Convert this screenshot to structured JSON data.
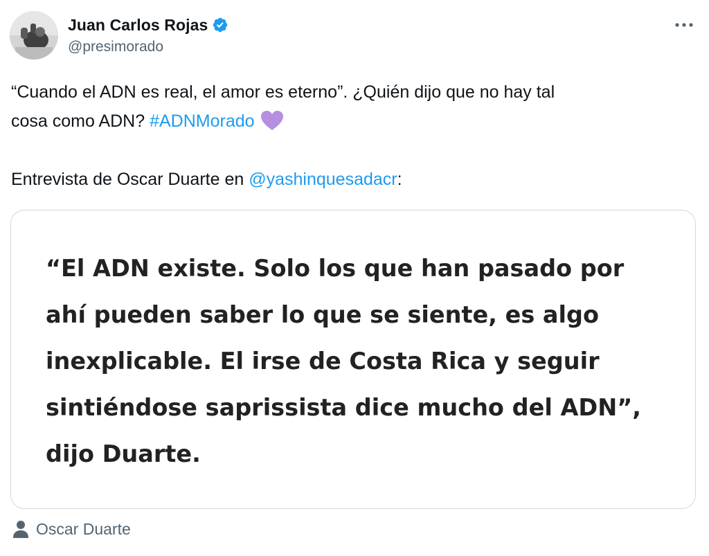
{
  "author": {
    "display_name": "Juan Carlos Rojas",
    "handle": "@presimorado",
    "verified": true,
    "avatar_icon": "avatar-photo",
    "verified_icon": "verified-badge-icon",
    "verified_color": "#1d9bf0"
  },
  "menu": {
    "icon": "more-horizontal-icon"
  },
  "tweet": {
    "line1_text": "“Cuando el ADN es real, el amor es eterno”.  ¿Quién dijo que no hay tal",
    "line2_text": "cosa como ADN?  ",
    "hashtag": "#ADNMorado",
    "emoji_icon": "purple-heart-icon",
    "emoji_color": "#b58fe0",
    "line3_text": "Entrevista de Oscar Duarte en ",
    "mention": "@yashinquesadacr",
    "line3_suffix": ":",
    "link_color": "#1d9bf0"
  },
  "media_card": {
    "quote_lines": [
      "“El ADN existe. Solo los que han pasado por",
      "ahí pueden saber lo que se siente, es algo",
      "inexplicable. El irse de Costa Rica y seguir",
      "sintiéndose saprissista dice mucho del ADN”,",
      "dijo Duarte."
    ]
  },
  "media_credit": {
    "icon": "person-icon",
    "name": "Oscar Duarte"
  }
}
